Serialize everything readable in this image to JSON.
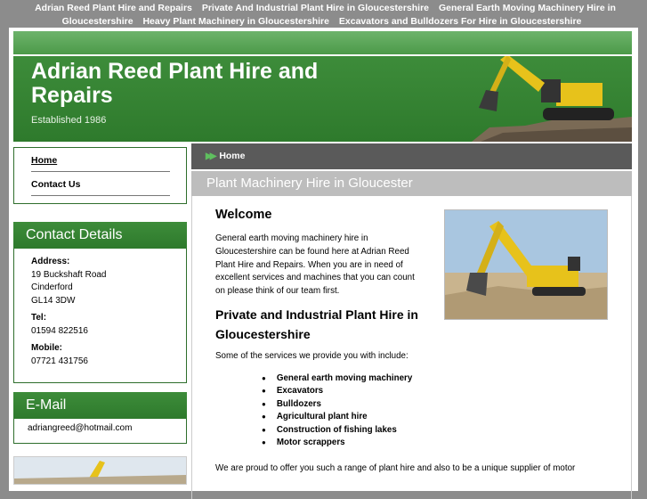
{
  "top_links": [
    "Adrian Reed Plant Hire and Repairs",
    "Private And Industrial Plant Hire in Gloucestershire",
    "General Earth Moving Machinery Hire in Gloucestershire",
    "Heavy Plant Machinery in Gloucestershire",
    "Excavators and Bulldozers For Hire in Gloucestershire"
  ],
  "header": {
    "title": "Adrian Reed Plant Hire and Repairs",
    "established": "Established 1986"
  },
  "nav": [
    {
      "label": "Home",
      "active": true
    },
    {
      "label": "Contact Us",
      "active": false
    }
  ],
  "contact": {
    "heading": "Contact Details",
    "address_label": "Address:",
    "address_lines": [
      "19 Buckshaft Road",
      "Cinderford",
      "GL14 3DW"
    ],
    "tel_label": "Tel:",
    "tel": "01594 822516",
    "mobile_label": "Mobile:",
    "mobile": "07721 431756"
  },
  "email": {
    "heading": "E-Mail",
    "address": "adriangreed@hotmail.com"
  },
  "breadcrumb": "Home",
  "page_subtitle": "Plant Machinery Hire in Gloucester",
  "content": {
    "heading": "Welcome",
    "intro": "General earth moving machinery hire in Gloucestershire can be found here at Adrian Reed Plant Hire and Repairs. When you are in need of excellent services and machines that you can count on please think of our team first.",
    "subheading": "Private and Industrial Plant Hire in Gloucestershire",
    "services_intro": "Some of the services we provide you with include:",
    "services": [
      "General earth moving machinery",
      "Excavators",
      "Bulldozers",
      "Agricultural plant hire",
      "Construction of fishing lakes",
      "Motor scrappers"
    ],
    "closing": "We are proud to offer you such a range of plant hire and also to be a unique supplier of motor"
  },
  "colors": {
    "brand_green": "#2e7a2c",
    "page_background": "#8c8c8c",
    "breadcrumb_bar": "#5a5a5a",
    "subtitle_bar": "#bdbdbd"
  },
  "icons": [
    "excavator-banner-image",
    "breadcrumb-arrows-icon",
    "bullet-icon"
  ]
}
